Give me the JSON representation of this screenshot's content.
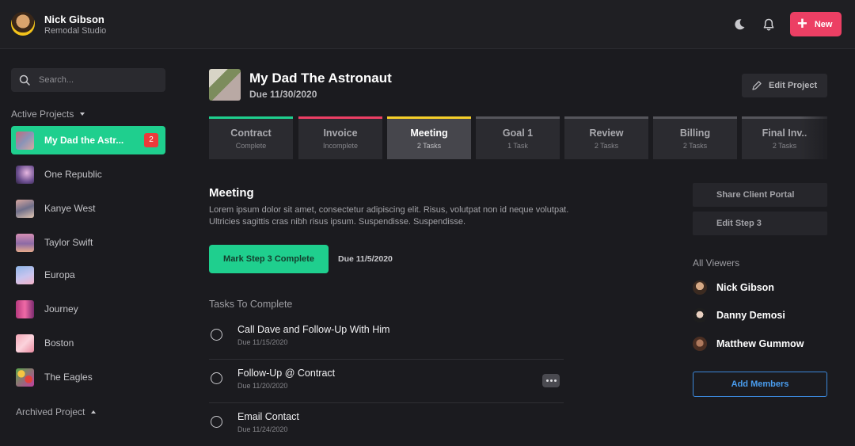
{
  "user": {
    "name": "Nick Gibson",
    "org": "Remodal Studio"
  },
  "header": {
    "new_label": "New",
    "icons": [
      "moon-icon",
      "bell-icon",
      "plus-icon"
    ]
  },
  "sidebar": {
    "search_placeholder": "Search...",
    "active_heading": "Active Projects",
    "archived_heading": "Archived Project",
    "projects": [
      {
        "label": "My Dad the Astr...",
        "badge": "2",
        "active": true
      },
      {
        "label": "One Republic"
      },
      {
        "label": "Kanye West"
      },
      {
        "label": "Taylor Swift"
      },
      {
        "label": "Europa"
      },
      {
        "label": "Journey"
      },
      {
        "label": "Boston"
      },
      {
        "label": "The Eagles"
      }
    ]
  },
  "project": {
    "title": "My Dad The Astronaut",
    "due": "Due 11/30/2020",
    "edit_label": "Edit Project"
  },
  "steps": [
    {
      "title": "Contract",
      "sub": "Complete",
      "color": "#1fcf8e"
    },
    {
      "title": "Invoice",
      "sub": "Incomplete",
      "color": "#ec3f64"
    },
    {
      "title": "Meeting",
      "sub": "2 Tasks",
      "color": "#f5cf2a"
    },
    {
      "title": "Goal 1",
      "sub": "1 Task",
      "color": "#55555b"
    },
    {
      "title": "Review",
      "sub": "2 Tasks",
      "color": "#55555b"
    },
    {
      "title": "Billing",
      "sub": "2 Tasks",
      "color": "#55555b"
    },
    {
      "title": "Final Inv..",
      "sub": "2 Tasks",
      "color": "#55555b"
    }
  ],
  "meeting": {
    "title": "Meeting",
    "description": "Lorem ipsum dolor sit amet, consectetur adipiscing elit. Risus, volutpat non id neque volutpat. Ultricies sagittis cras nibh risus ipsum. Suspendisse. Suspendisse.",
    "mark_label": "Mark Step 3 Complete",
    "due": "Due 11/5/2020",
    "tasks_heading": "Tasks To Complete",
    "tasks": [
      {
        "label": "Call Dave and Follow-Up With Him",
        "due": "Due 11/15/2020"
      },
      {
        "label": "Follow-Up @ Contract",
        "due": "Due 11/20/2020"
      },
      {
        "label": "Email Contact",
        "due": "Due 11/24/2020"
      }
    ]
  },
  "right": {
    "share_label": "Share Client Portal",
    "edit_step_label": "Edit Step 3",
    "viewers_heading": "All Viewers",
    "viewers": [
      "Nick Gibson",
      "Danny Demosi",
      "Matthew Gummow"
    ],
    "add_members_label": "Add Members"
  },
  "colors": {
    "accent_green": "#1fcf8e",
    "accent_pink": "#ec3f64",
    "accent_yellow": "#f5cf2a",
    "link_blue": "#4a9ef0"
  }
}
